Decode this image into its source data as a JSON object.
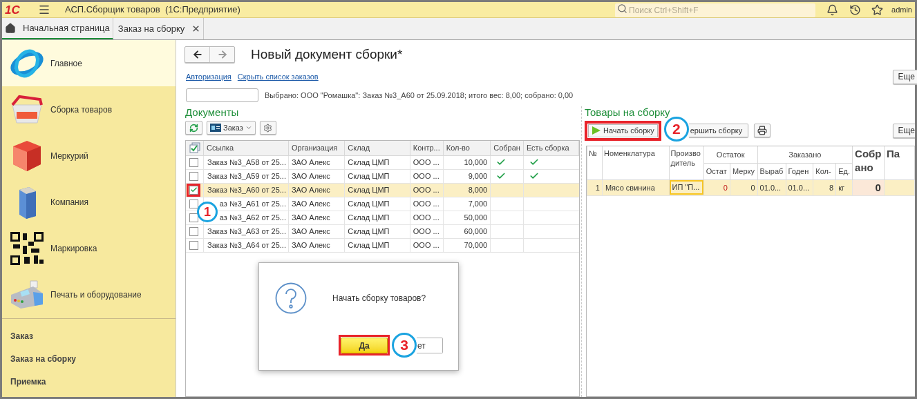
{
  "app": {
    "logo": "1С",
    "title": "АСП.Сборщик товаров  (1С:Предприятие)",
    "search_placeholder": "Поиск Ctrl+Shift+F",
    "user": "admin"
  },
  "tabs": [
    {
      "label": "Начальная страница",
      "selected": true,
      "kind": "home"
    },
    {
      "label": "Заказ на сборку",
      "selected": false,
      "kind": "closable"
    }
  ],
  "sidebar": {
    "sections": [
      {
        "label": "Главное",
        "selected": true,
        "kind": "globe"
      },
      {
        "label": "Сборка товаров",
        "selected": false,
        "kind": "basket"
      },
      {
        "label": "Меркурий",
        "selected": false,
        "kind": "cube"
      },
      {
        "label": "Компания",
        "selected": false,
        "kind": "building"
      },
      {
        "label": "Маркировка",
        "selected": false,
        "kind": "qr"
      },
      {
        "label": "Печать и оборудование",
        "selected": false,
        "kind": "terminal"
      }
    ],
    "links": [
      "Заказ",
      "Заказ на сборку",
      "Приемка"
    ]
  },
  "document": {
    "title": "Новый документ сборки*",
    "links": [
      "Авторизация",
      "Скрыть список заказов"
    ],
    "more_button": "Еще",
    "selection_text": "Выбрано: ООО \"Ромашка\": Заказ №3_А60 от 25.09.2018; итого вес: 8,00; собрано: 0,00",
    "documents": {
      "title": "Документы",
      "order_button": "Заказ",
      "columns": [
        "Ссылка",
        "Организация",
        "Склад",
        "Контр...",
        "Кол-во",
        "Собран",
        "Есть сборка"
      ],
      "rows": [
        {
          "link": "Заказ №3_А58 от 25...",
          "org": "ЗАО Алекс",
          "warehouse": "Склад ЦМП",
          "contractor": "ООО ...",
          "qty": "10,000",
          "collected": true,
          "has_assembly": true,
          "checked": false,
          "selected": false
        },
        {
          "link": "Заказ №3_А59 от 25...",
          "org": "ЗАО Алекс",
          "warehouse": "Склад ЦМП",
          "contractor": "ООО ...",
          "qty": "9,000",
          "collected": true,
          "has_assembly": true,
          "checked": false,
          "selected": false
        },
        {
          "link": "Заказ №3_А60 от 25...",
          "org": "ЗАО Алекс",
          "warehouse": "Склад ЦМП",
          "contractor": "ООО ...",
          "qty": "8,000",
          "collected": false,
          "has_assembly": false,
          "checked": true,
          "selected": true,
          "callout": "1"
        },
        {
          "link": "аз №3_А61 от 25...",
          "org": "ЗАО Алекс",
          "warehouse": "Склад ЦМП",
          "contractor": "ООО ...",
          "qty": "7,000",
          "collected": false,
          "has_assembly": false,
          "checked": false,
          "selected": false
        },
        {
          "link": "аз №3_А62 от 25...",
          "org": "ЗАО Алекс",
          "warehouse": "Склад ЦМП",
          "contractor": "ООО ...",
          "qty": "50,000",
          "collected": false,
          "has_assembly": false,
          "checked": false,
          "selected": false
        },
        {
          "link": "Заказ №3_А63 от 25...",
          "org": "ЗАО Алекс",
          "warehouse": "Склад ЦМП",
          "contractor": "ООО ...",
          "qty": "60,000",
          "collected": false,
          "has_assembly": false,
          "checked": false,
          "selected": false
        },
        {
          "link": "Заказ №3_А64 от 25...",
          "org": "ЗАО Алекс",
          "warehouse": "Склад ЦМП",
          "contractor": "ООО ...",
          "qty": "70,000",
          "collected": false,
          "has_assembly": false,
          "checked": false,
          "selected": false
        }
      ]
    },
    "goods": {
      "title": "Товары на сборку",
      "start_button": {
        "label": "Начать сборку",
        "callout": "2"
      },
      "finish_button": "ершить сборку",
      "more_button": "Еще",
      "columns": [
        {
          "label": "№",
          "kind": "plain"
        },
        {
          "label": "Номенклатура",
          "kind": "plain"
        },
        {
          "label": "Производитель",
          "kind": "plain"
        },
        {
          "label": "Остаток",
          "kind": "group",
          "children": [
            "Остат",
            "Мерку"
          ]
        },
        {
          "label": "Заказано",
          "kind": "group",
          "children": [
            "Выраб",
            "Годен",
            "Кол-",
            "Ед."
          ]
        },
        {
          "label": "Собрано",
          "kind": "big"
        },
        {
          "label": "Па",
          "kind": "big"
        }
      ],
      "rows": [
        {
          "number": "1",
          "name": "Мясо свинина",
          "producer": "ИП \"П...",
          "producer_focused": true,
          "stock": "0",
          "stock_alert": true,
          "mercury": "0",
          "produced": "01.0...",
          "expires": "01.0...",
          "qty": "8",
          "unit": "кг",
          "collected": "0",
          "selected": true
        }
      ]
    }
  },
  "dialog": {
    "message": "Начать сборку товаров?",
    "buttons": [
      {
        "label": "Да",
        "default": true,
        "callout": "3"
      },
      {
        "label": "ет",
        "default": false
      }
    ]
  }
}
